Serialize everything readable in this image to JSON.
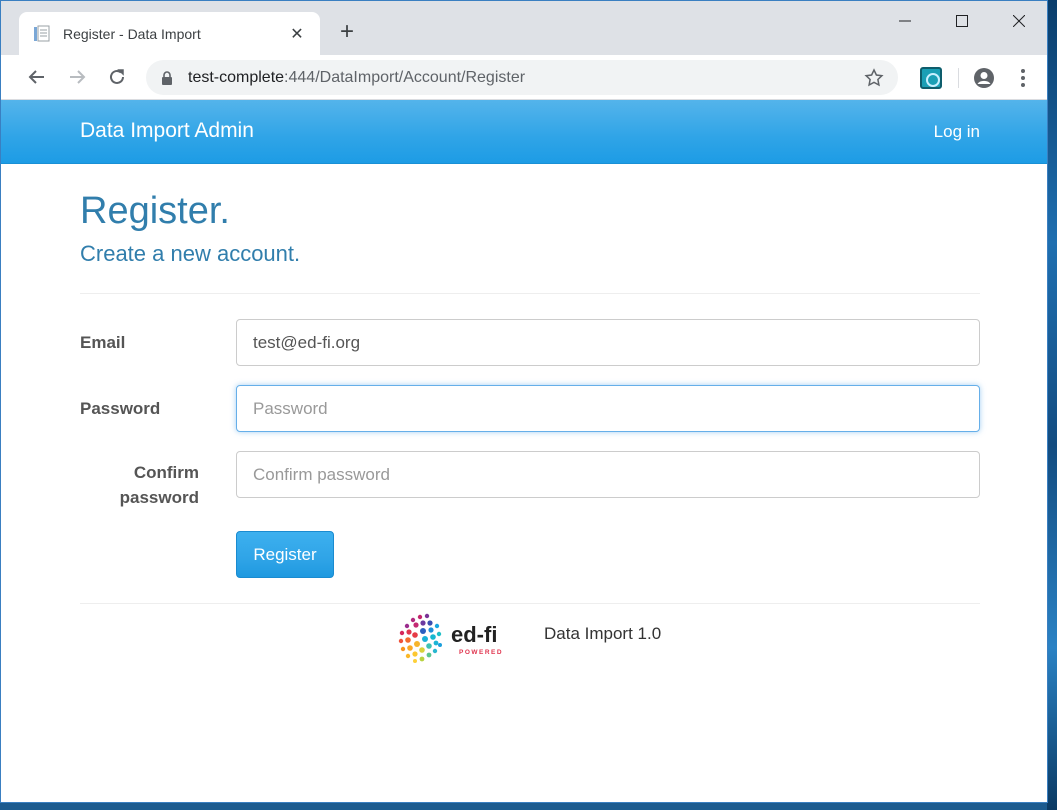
{
  "browser": {
    "tab_title": "Register - Data Import",
    "new_tab_label": "+",
    "url_host": "test-complete",
    "url_rest": ":444/DataImport/Account/Register"
  },
  "nav": {
    "brand": "Data Import Admin",
    "login": "Log in"
  },
  "page": {
    "title": "Register.",
    "subtitle": "Create a new account."
  },
  "form": {
    "email_label": "Email",
    "email_value": "test@ed-fi.org",
    "password_label": "Password",
    "password_placeholder": "Password",
    "confirm_label_line1": "Confirm",
    "confirm_label_line2": "password",
    "confirm_placeholder": "Confirm password",
    "submit_label": "Register"
  },
  "footer": {
    "logo_text": "ed-fi",
    "logo_sub": "POWERED",
    "version": "Data Import 1.0"
  },
  "colors": {
    "navbar": "#2fa4e7",
    "heading": "#317eac",
    "button": "#2fa4e7"
  }
}
